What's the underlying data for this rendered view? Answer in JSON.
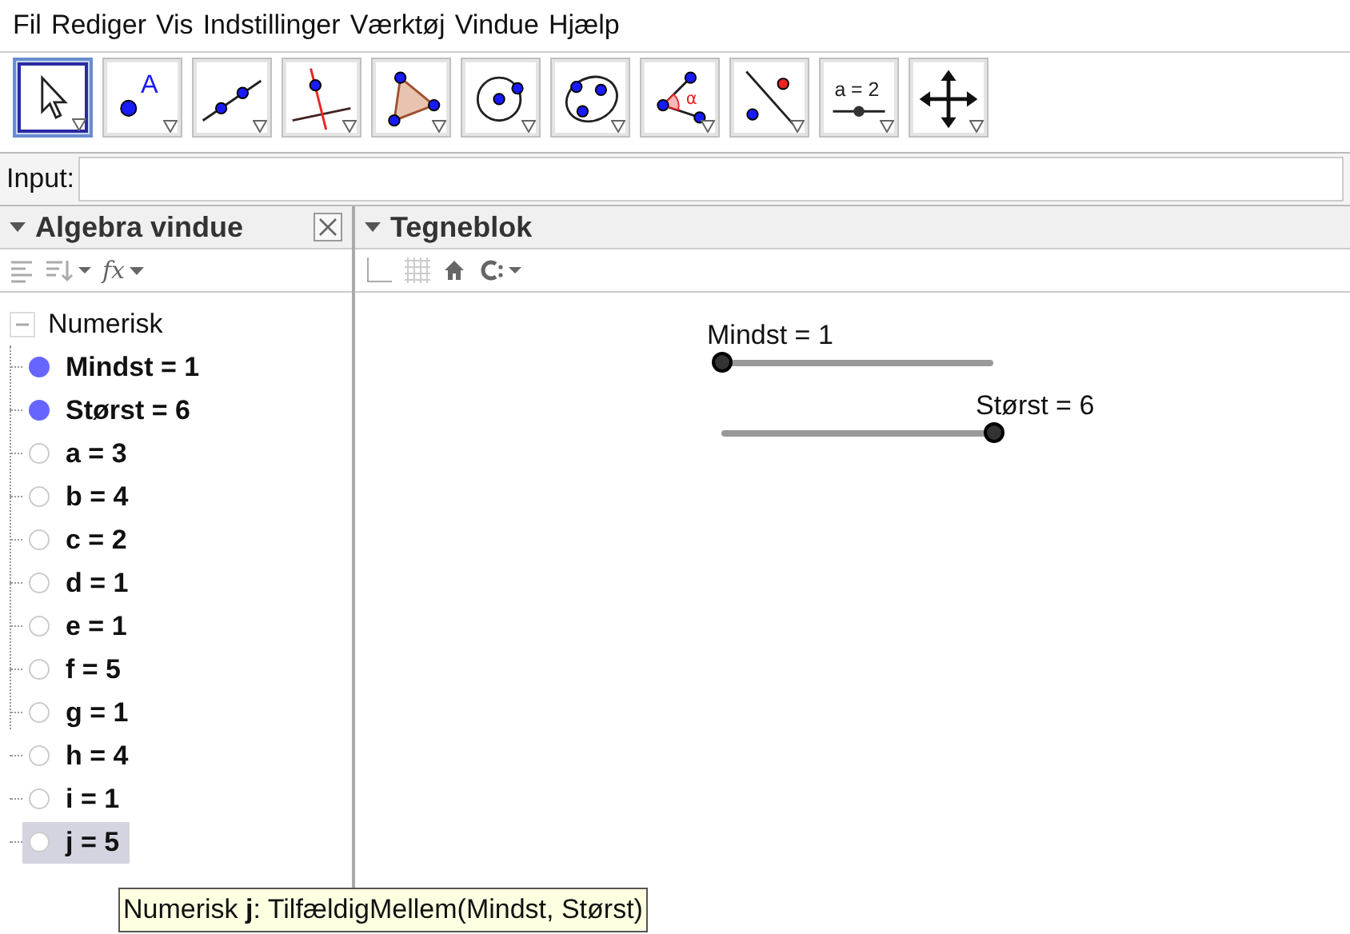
{
  "menu": [
    "Fil",
    "Rediger",
    "Vis",
    "Indstillinger",
    "Værktøj",
    "Vindue",
    "Hjælp"
  ],
  "toolbar": [
    {
      "kind": "pointer",
      "selected": true
    },
    {
      "kind": "point",
      "selected": false,
      "label": "A"
    },
    {
      "kind": "line",
      "selected": false
    },
    {
      "kind": "perpendicular",
      "selected": false
    },
    {
      "kind": "polygon",
      "selected": false
    },
    {
      "kind": "circle",
      "selected": false
    },
    {
      "kind": "conic",
      "selected": false
    },
    {
      "kind": "angle",
      "selected": false,
      "label": "α"
    },
    {
      "kind": "reflect",
      "selected": false
    },
    {
      "kind": "slider",
      "selected": false,
      "label": "a = 2"
    },
    {
      "kind": "move",
      "selected": false
    }
  ],
  "input": {
    "label": "Input:"
  },
  "algebra": {
    "title": "Algebra vindue",
    "function_button": "fx",
    "group": {
      "label": "Numerisk",
      "expanded": true,
      "children": [
        {
          "text": "Mindst = 1",
          "shown": true,
          "selected": false
        },
        {
          "text": "Størst = 6",
          "shown": true,
          "selected": false
        },
        {
          "text": "a = 3",
          "shown": false,
          "selected": false
        },
        {
          "text": "b = 4",
          "shown": false,
          "selected": false
        },
        {
          "text": "c = 2",
          "shown": false,
          "selected": false
        },
        {
          "text": "d = 1",
          "shown": false,
          "selected": false
        },
        {
          "text": "e = 1",
          "shown": false,
          "selected": false
        },
        {
          "text": "f = 5",
          "shown": false,
          "selected": false
        },
        {
          "text": "g = 1",
          "shown": false,
          "selected": false
        },
        {
          "text": "h = 4",
          "shown": false,
          "selected": false
        },
        {
          "text": "i = 1",
          "shown": false,
          "selected": false
        },
        {
          "text": "j = 5",
          "shown": false,
          "selected": true
        }
      ]
    }
  },
  "graphics": {
    "title": "Tegneblok",
    "sliders": [
      {
        "label": "Mindst = 1",
        "level": 0
      },
      {
        "label": "Størst = 6",
        "level": 1
      }
    ]
  },
  "tooltip": "Numerisk **j**: TilfældigMellem(Mindst, Størst)"
}
